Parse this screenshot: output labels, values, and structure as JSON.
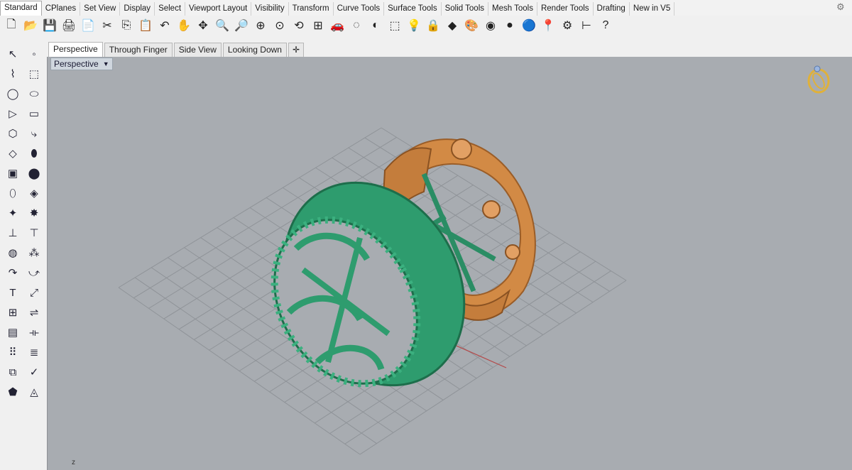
{
  "top_tabs": [
    "Standard",
    "CPlanes",
    "Set View",
    "Display",
    "Select",
    "Viewport Layout",
    "Visibility",
    "Transform",
    "Curve Tools",
    "Surface Tools",
    "Solid Tools",
    "Mesh Tools",
    "Render Tools",
    "Drafting",
    "New in V5"
  ],
  "active_top_tab": "Standard",
  "toolbar_icons": [
    "new-file-icon",
    "open-folder-icon",
    "save-icon",
    "print-icon",
    "import-icon",
    "cut-icon",
    "copy-icon",
    "paste-icon",
    "undo-icon",
    "pan-hand-icon",
    "move-icon",
    "zoom-icon",
    "zoom-window-icon",
    "zoom-extents-icon",
    "zoom-selected-icon",
    "rotate-view-icon",
    "four-viewports-icon",
    "car-named-view-icon",
    "layer-icon",
    "object-properties-icon",
    "select-icon",
    "light-bulb-icon",
    "lock-icon",
    "render-material-icon",
    "color-wheel-icon",
    "shaded-sphere-icon",
    "rendered-sphere-icon",
    "blue-sphere-icon",
    "pin-icon",
    "options-gear-icon",
    "grid-snap-icon",
    "help-icon"
  ],
  "toolbar_glyphs": [
    "🗋",
    "📂",
    "💾",
    "🖨",
    "📄",
    "✂",
    "⎘",
    "📋",
    "↶",
    "✋",
    "✥",
    "🔍",
    "🔎",
    "⊕",
    "⊙",
    "⟲",
    "⊞",
    "🚗",
    "◌",
    "◐",
    "⬚",
    "💡",
    "🔒",
    "◆",
    "🎨",
    "◉",
    "●",
    "🔵",
    "📍",
    "⚙",
    "⊢",
    "?"
  ],
  "sidebar_icons": [
    [
      "select-arrow-icon",
      "point-icon"
    ],
    [
      "polyline-icon",
      "curve-points-icon"
    ],
    [
      "circle-icon",
      "ellipse-icon"
    ],
    [
      "polygon-icon",
      "rectangle-icon"
    ],
    [
      "surface-icon",
      "arc-curve-icon"
    ],
    [
      "surface-edit-icon",
      "loft-icon"
    ],
    [
      "box-solid-icon",
      "sphere-solid-icon"
    ],
    [
      "cylinder-icon",
      "mesh-icon"
    ],
    [
      "array-icon",
      "explode-icon"
    ],
    [
      "trim-icon",
      "split-icon"
    ],
    [
      "boolean-icon",
      "group-icon"
    ],
    [
      "fillet-icon",
      "chamfer-icon"
    ],
    [
      "text-icon",
      "scale-icon"
    ],
    [
      "block-icon",
      "mirror-icon"
    ],
    [
      "extrude-icon",
      "dimension-icon"
    ],
    [
      "array-grid-icon",
      "layer-stack-icon"
    ],
    [
      "flow-icon",
      "check-icon"
    ],
    [
      "analyze-icon",
      "render-light-icon"
    ]
  ],
  "sidebar_glyphs": [
    [
      "↖",
      "◦"
    ],
    [
      "⌇",
      "⬚"
    ],
    [
      "◯",
      "⬭"
    ],
    [
      "▷",
      "▭"
    ],
    [
      "⬡",
      "⤷"
    ],
    [
      "◇",
      "⬮"
    ],
    [
      "▣",
      "⬤"
    ],
    [
      "⬯",
      "◈"
    ],
    [
      "✦",
      "✸"
    ],
    [
      "⊥",
      "⊤"
    ],
    [
      "◍",
      "⁂"
    ],
    [
      "↷",
      "⤻"
    ],
    [
      "T",
      "⤢"
    ],
    [
      "⊞",
      "⇌"
    ],
    [
      "▤",
      "⟛"
    ],
    [
      "⠿",
      "≣"
    ],
    [
      "⧉",
      "✓"
    ],
    [
      "⬟",
      "◬"
    ]
  ],
  "viewport_tabs": [
    "Perspective",
    "Through Finger",
    "Side View",
    "Looking Down"
  ],
  "active_viewport_tab": "Perspective",
  "viewport_title": "Perspective",
  "axis_label": "z",
  "colors": {
    "viewport_bg": "#a8acb1",
    "grid": "#8f9398",
    "green_ring": "#2e9c6e",
    "gold_ring": "#d28a45"
  }
}
